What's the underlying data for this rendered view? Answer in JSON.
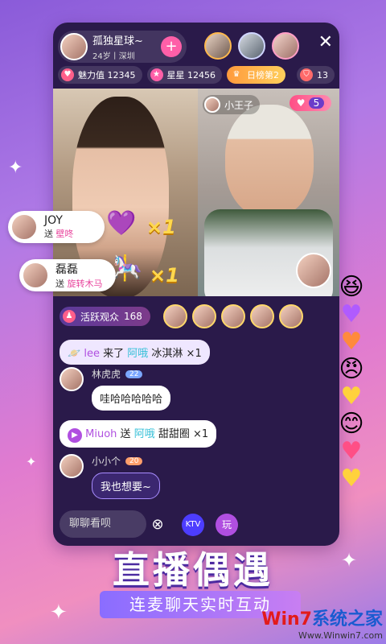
{
  "host": {
    "name": "孤独星球~",
    "sub": "24岁丨深圳",
    "follow": "+"
  },
  "stats": {
    "charm": "魅力值 12345",
    "stars": "星星 12456",
    "rank": "日榜第2",
    "count": "13"
  },
  "close": "✕",
  "videos": {
    "right_name": "小王子",
    "heart_value": "5"
  },
  "gifts": [
    {
      "name": "JOY",
      "verb": "送",
      "item": "壁咚",
      "times": "×1"
    },
    {
      "name": "磊磊",
      "verb": "送",
      "item": "旋转木马",
      "times": "×1"
    }
  ],
  "audience": {
    "label": "活跃观众",
    "count": "168"
  },
  "chat": {
    "msg1": {
      "user": "lee",
      "join": "来了",
      "target": "阿哦",
      "gift": "冰淇淋",
      "times": "×1"
    },
    "msg2": {
      "user": "林虎虎",
      "level": "22",
      "text": "哇哈哈哈哈哈"
    },
    "msg3": {
      "user": "Miuoh",
      "verb": "送",
      "target": "阿哦",
      "gift": "甜甜圈",
      "times": "×1"
    },
    "msg4": {
      "user": "小小个",
      "level": "20",
      "text": "我也想要~"
    }
  },
  "input": {
    "placeholder": "聊聊看呗"
  },
  "tools": {
    "ktv": "KTV",
    "play": "玩"
  },
  "headline": "直播偶遇",
  "subline": "连麦聊天实时互动",
  "watermark": {
    "brand_a": "Win7",
    "brand_b": "系统之家",
    "url": "Www.Winwin7.com"
  }
}
